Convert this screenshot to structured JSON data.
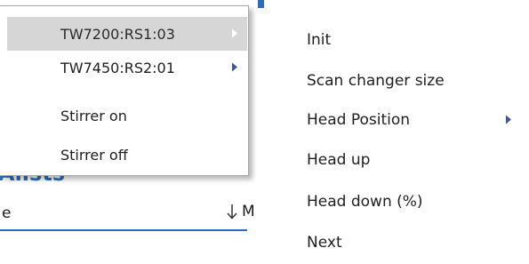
{
  "background": {
    "heading_fragment": "Alists",
    "left_col_fragment": "e",
    "right_col_fragment": "M",
    "sort_icon": "arrow-down-icon"
  },
  "left_menu": {
    "items": [
      {
        "label": "TW7200:RS1:03",
        "has_submenu": true,
        "highlighted": true
      },
      {
        "label": "TW7450:RS2:01",
        "has_submenu": true,
        "highlighted": false
      },
      {
        "label": "Stirrer on",
        "has_submenu": false,
        "highlighted": false
      },
      {
        "label": "Stirrer off",
        "has_submenu": false,
        "highlighted": false
      }
    ]
  },
  "right_menu": {
    "items": [
      {
        "label": "Init",
        "has_submenu": false
      },
      {
        "label": "Scan changer size",
        "has_submenu": false
      },
      {
        "label": "Head Position",
        "has_submenu": true
      },
      {
        "label": "Head up",
        "has_submenu": false
      },
      {
        "label": "Head down (%)",
        "has_submenu": false
      },
      {
        "label": "Next",
        "has_submenu": false
      }
    ]
  },
  "colors": {
    "accent_blue": "#2b6cb8",
    "highlight_bg": "#d6d6d6",
    "arrow_active": "#ffffff",
    "arrow_normal": "#3a56a5"
  }
}
